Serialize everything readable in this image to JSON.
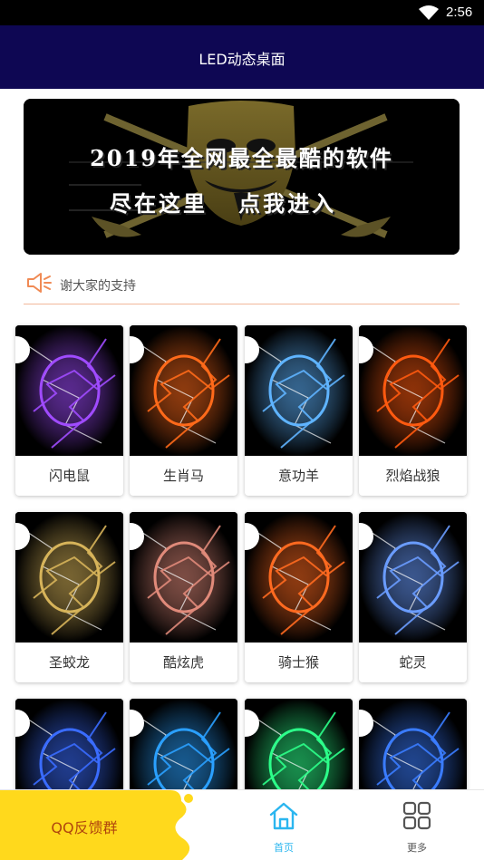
{
  "status_bar": {
    "time": "2:56",
    "wifi_icon": "wifi-icon"
  },
  "header": {
    "title": "LED动态桌面"
  },
  "banner": {
    "line1": "2019年全网最全最酷的软件",
    "line2": "尽在这里   点我进入"
  },
  "notice": {
    "icon": "speaker-icon",
    "text": "谢大家的支持"
  },
  "wallpapers": [
    {
      "label": "闪电鼠",
      "glow": "#a04bff"
    },
    {
      "label": "生肖马",
      "glow": "#ff6a1a"
    },
    {
      "label": "意功羊",
      "glow": "#5fb4ff"
    },
    {
      "label": "烈焰战狼",
      "glow": "#ff5a10"
    },
    {
      "label": "圣蛟龙",
      "glow": "#d7b45a"
    },
    {
      "label": "酷炫虎",
      "glow": "#e08a7a"
    },
    {
      "label": "骑士猴",
      "glow": "#ff6a20"
    },
    {
      "label": "蛇灵",
      "glow": "#6a9cff"
    },
    {
      "label": "",
      "glow": "#3a6cff"
    },
    {
      "label": "",
      "glow": "#2aa0ff"
    },
    {
      "label": "",
      "glow": "#2cff8a"
    },
    {
      "label": "",
      "glow": "#3a7cff"
    }
  ],
  "bottom_nav": {
    "feedback_label": "QQ反馈群",
    "home_label": "首页",
    "more_label": "更多",
    "active_color": "#2bb6ef",
    "inactive_color": "#555555"
  }
}
